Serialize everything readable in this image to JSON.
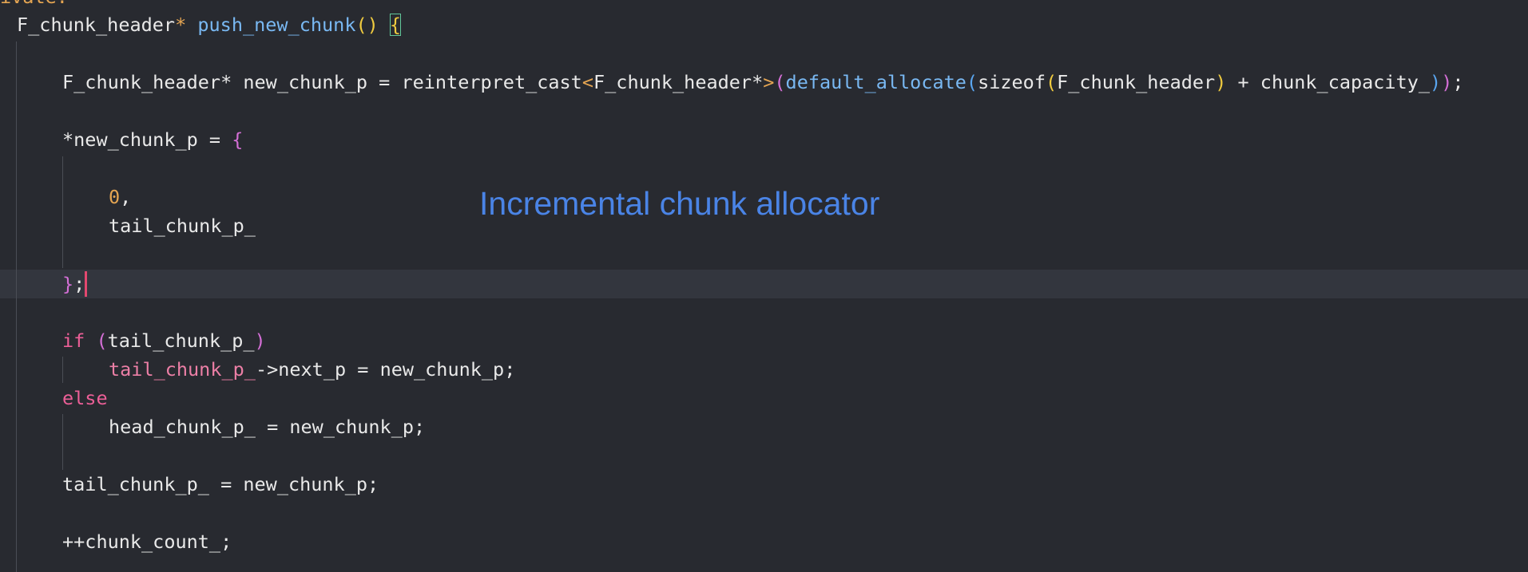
{
  "header_fragment": "ivate:",
  "overlay_caption": "Incremental chunk allocator",
  "code": {
    "l1": {
      "type": "F_chunk_header",
      "star": "*",
      "space": " ",
      "func": "push_new_chunk",
      "parens": "()",
      "brace": "{"
    },
    "l2": {
      "type": "F_chunk_header",
      "star": "*",
      "decl": " new_chunk_p = reinterpret_cast",
      "lt": "<",
      "tmpl": "F_chunk_header",
      "tmpl_star": "*",
      "gt": ">",
      "open1": "(",
      "alloc": "default_allocate",
      "open2": "(",
      "sizeof": "sizeof",
      "open3": "(",
      "arg": "F_chunk_header",
      "close3": ")",
      "plus": " + chunk_capacity_",
      "close2": ")",
      "close1": ")",
      "semi": ";"
    },
    "l3": {
      "deref": "*new_chunk_p = ",
      "brace": "{"
    },
    "l4": {
      "num": "0",
      "comma": ","
    },
    "l5": {
      "text": "tail_chunk_p_"
    },
    "l6": {
      "brace": "}",
      "semi": ";"
    },
    "l7": {
      "kw": "if",
      "space": " ",
      "open": "(",
      "cond": "tail_chunk_p_",
      "close": ")"
    },
    "l8": {
      "member": "tail_chunk_p_",
      "rest": "->next_p = new_chunk_p;"
    },
    "l9": {
      "kw": "else"
    },
    "l10": {
      "text": "head_chunk_p_ = new_chunk_p;"
    },
    "l11": {
      "text": "tail_chunk_p_ = new_chunk_p;"
    },
    "l12": {
      "text": "++chunk_count_;"
    }
  }
}
